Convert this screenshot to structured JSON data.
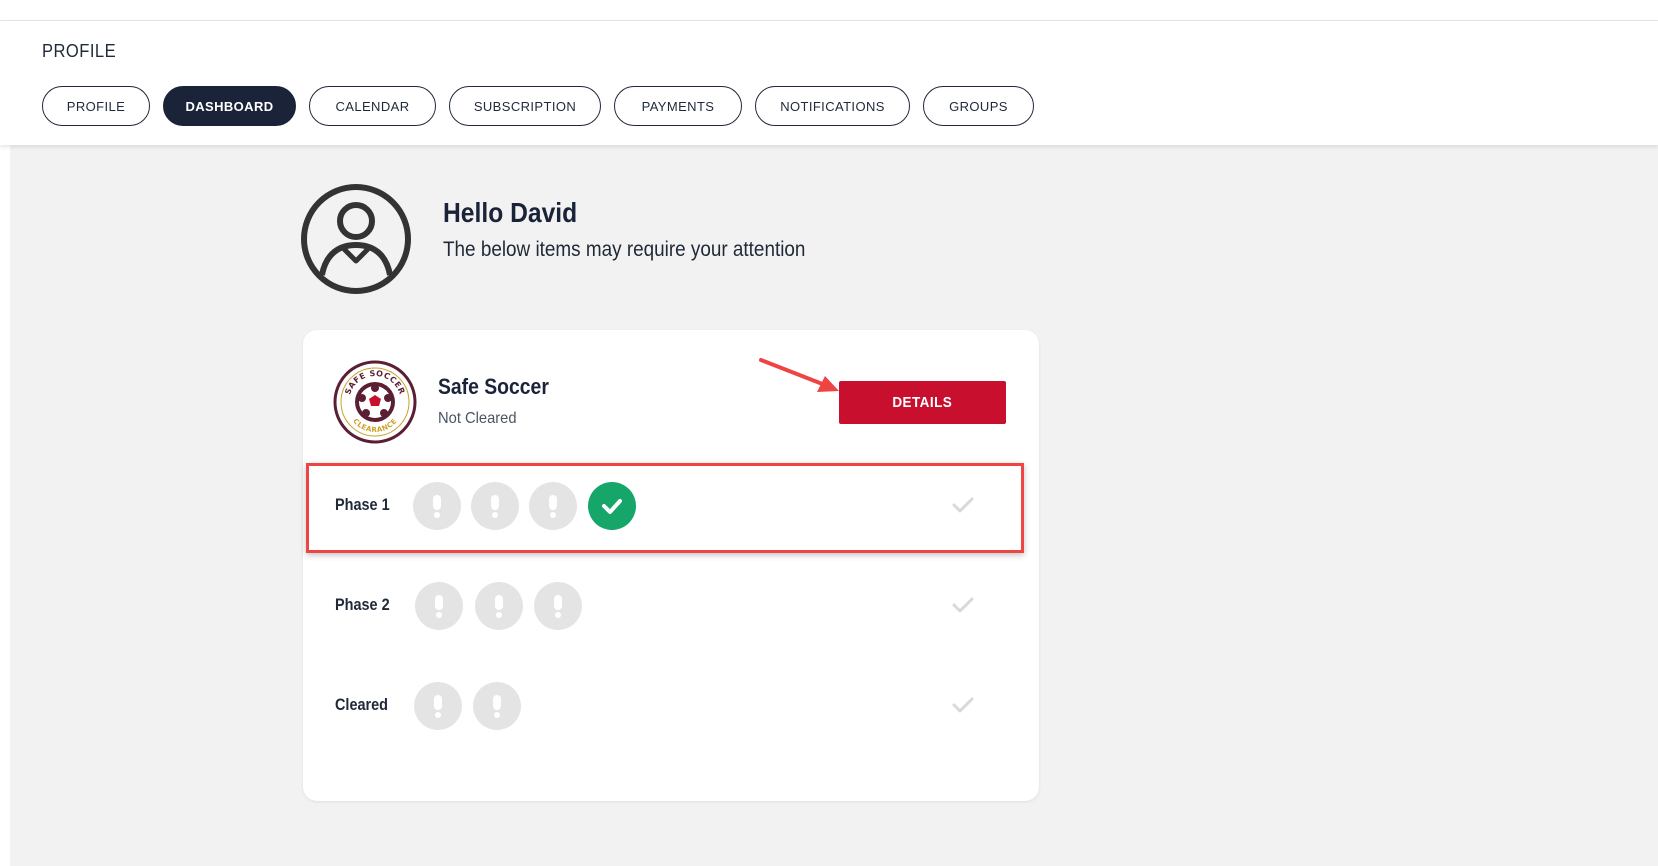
{
  "header": {
    "title": "PROFILE",
    "tabs": [
      {
        "label": "PROFILE",
        "active": false
      },
      {
        "label": "DASHBOARD",
        "active": true
      },
      {
        "label": "CALENDAR",
        "active": false
      },
      {
        "label": "SUBSCRIPTION",
        "active": false
      },
      {
        "label": "PAYMENTS",
        "active": false
      },
      {
        "label": "NOTIFICATIONS",
        "active": false
      },
      {
        "label": "GROUPS",
        "active": false
      }
    ]
  },
  "greeting": {
    "title": "Hello David",
    "subtitle": "The below items may require your attention"
  },
  "card": {
    "title": "Safe Soccer",
    "status": "Not Cleared",
    "details_label": "DETAILS",
    "logo_text_top": "SAFE SOCCER",
    "logo_text_bottom": "CLEARANCE",
    "phases": [
      {
        "label": "Phase 1",
        "items": [
          "pending",
          "pending",
          "pending",
          "complete"
        ],
        "highlighted": true
      },
      {
        "label": "Phase 2",
        "items": [
          "pending",
          "pending",
          "pending"
        ],
        "highlighted": false
      },
      {
        "label": "Cleared",
        "items": [
          "pending",
          "pending"
        ],
        "highlighted": false
      }
    ]
  },
  "colors": {
    "nav_active": "#1b2338",
    "details_button": "#c8102e",
    "complete": "#16a66a",
    "pending": "#e4e4e4",
    "annotation": "#ef4444"
  },
  "icons": {
    "avatar": "user-circle-icon",
    "pending": "exclamation-icon",
    "complete": "checkmark-icon",
    "row_status": "checkmark-icon",
    "annotation": "arrow-icon"
  }
}
